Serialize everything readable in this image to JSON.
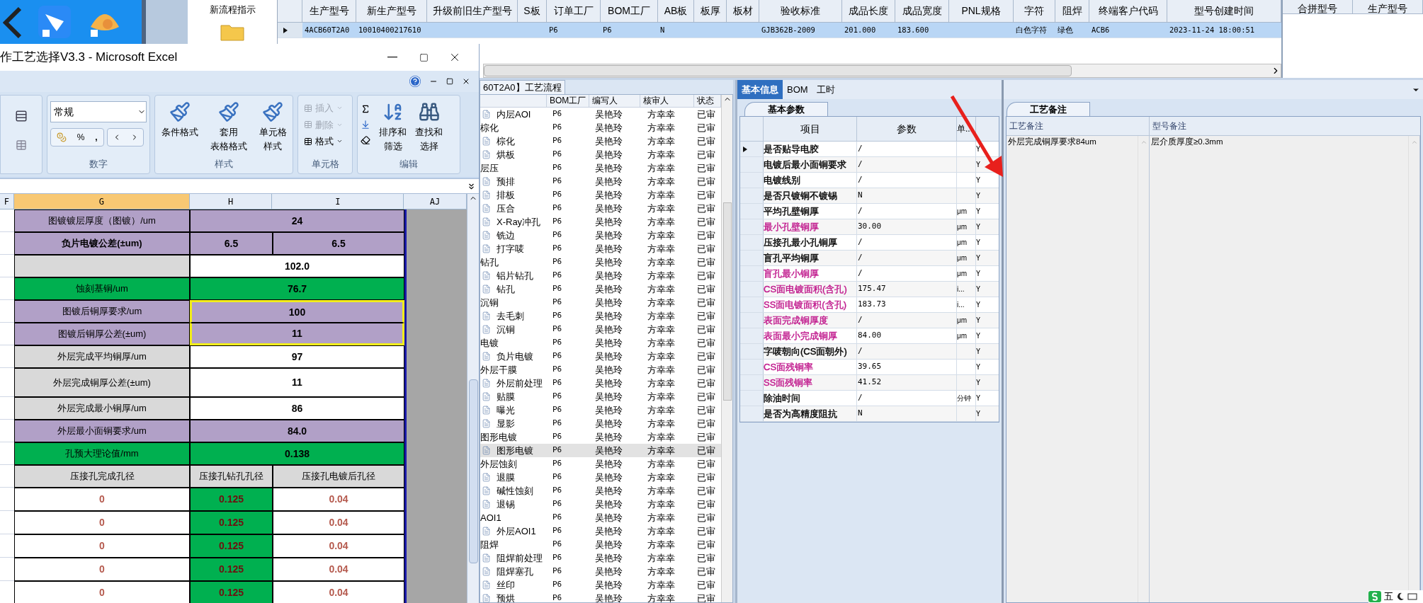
{
  "flow_panel": {
    "label": "新流程指示"
  },
  "model_grid": {
    "columns": [
      {
        "label": "生产型号"
      },
      {
        "label": "新生产型号"
      },
      {
        "label": "升级前旧生产型号"
      },
      {
        "label": "S板"
      },
      {
        "label": "订单工厂"
      },
      {
        "label": "BOM工厂"
      },
      {
        "label": "AB板"
      },
      {
        "label": "板厚"
      },
      {
        "label": "板材"
      },
      {
        "label": "验收标准"
      },
      {
        "label": "成品长度"
      },
      {
        "label": "成品宽度"
      },
      {
        "label": "PNL规格"
      },
      {
        "label": "字符"
      },
      {
        "label": "阻焊"
      },
      {
        "label": "终端客户代码"
      },
      {
        "label": "型号创建时间"
      }
    ],
    "rows": [
      {
        "selected": true,
        "cells": [
          "4ACB60T2A0",
          "10010400217610",
          "",
          "",
          "P6",
          "P6",
          "N",
          "",
          "",
          "GJB362B-2009",
          "201.000",
          "183.600",
          "",
          "白色字符",
          "绿色",
          "ACB6",
          "2023-11-24 18:00:51"
        ]
      }
    ]
  },
  "merge_grid": {
    "columns": [
      "合拼型号",
      "生产型号"
    ]
  },
  "excel": {
    "title": "作工艺选择V3.3 - Microsoft Excel",
    "number_format": "常规",
    "percent": "%",
    "comma": ",",
    "groups": [
      {
        "kind": "number",
        "label": "数字"
      },
      {
        "kind": "styles",
        "label": "样式"
      },
      {
        "kind": "cells",
        "label": "单元格"
      },
      {
        "kind": "editing",
        "label": "编辑"
      }
    ],
    "style_buttons": [
      {
        "lines": [
          "条件格式"
        ]
      },
      {
        "lines": [
          "套用",
          "表格格式"
        ]
      },
      {
        "lines": [
          "单元格",
          "样式"
        ]
      }
    ],
    "cell_buttons": [
      {
        "label": "插入",
        "disabled": true
      },
      {
        "label": "删除",
        "disabled": true
      },
      {
        "label": "格式",
        "disabled": false
      }
    ],
    "edit_buttons": [
      {
        "lines": [
          "排序和",
          "筛选"
        ]
      },
      {
        "lines": [
          "查找和",
          "选择"
        ]
      }
    ],
    "column_headers": [
      {
        "label": "F",
        "selected": false
      },
      {
        "label": "G",
        "selected": true
      },
      {
        "label": "H",
        "selected": false
      },
      {
        "label": "I",
        "selected": false
      },
      {
        "label": "AJ",
        "selected": false
      }
    ],
    "rows": [
      {
        "kind": "input",
        "label": "图镀镀层厚度（图镀）/um",
        "bold": false,
        "highlighted": false,
        "values": [
          "24"
        ]
      },
      {
        "kind": "input",
        "label": "负片电镀公差(±um)",
        "bold": true,
        "highlighted": false,
        "values": [
          "6.5",
          "6.5"
        ]
      },
      {
        "kind": "derived",
        "highlighted": false,
        "values": [
          "102.0"
        ]
      },
      {
        "kind": "result",
        "label": "蚀刻基铜/um",
        "bold": false,
        "highlighted": false,
        "values": [
          "76.7"
        ]
      },
      {
        "kind": "input",
        "label": "图镀后铜厚要求/um",
        "bold": false,
        "highlighted": true,
        "values": [
          "100"
        ]
      },
      {
        "kind": "input",
        "label": "图镀后铜厚公差(±um)",
        "bold": false,
        "highlighted": true,
        "values": [
          "11"
        ]
      },
      {
        "kind": "derived",
        "label": "外层完成平均铜厚/um",
        "bold": false,
        "highlighted": false,
        "values": [
          "97"
        ]
      },
      {
        "kind": "derived",
        "label": "外层完成铜厚公差(±um)",
        "bold": false,
        "highlighted": false,
        "values": [
          "11"
        ]
      },
      {
        "kind": "derived",
        "label": "外层完成最小铜厚/um",
        "bold": false,
        "highlighted": false,
        "values": [
          "86"
        ]
      },
      {
        "kind": "input",
        "label": "外层最小面铜要求/um",
        "bold": false,
        "highlighted": false,
        "values": [
          "84.0"
        ]
      },
      {
        "kind": "result",
        "label": "孔预大理论值/mm",
        "bold": false,
        "highlighted": false,
        "values": [
          "0.138"
        ]
      }
    ],
    "hole_table": {
      "columns": [
        "压接孔完成孔径",
        "压接孔钻孔孔径",
        "压接孔电镀后孔径"
      ],
      "rows": [
        [
          "0",
          "0.125",
          "0.04"
        ],
        [
          "0",
          "0.125",
          "0.04"
        ],
        [
          "0",
          "0.125",
          "0.04"
        ],
        [
          "0",
          "0.125",
          "0.04"
        ],
        [
          "0",
          "0.125",
          "0.04"
        ]
      ]
    }
  },
  "process": {
    "tab": "60T2A0】工艺流程",
    "columns": [
      "BOM工厂",
      "编写人",
      "核审人",
      "状态"
    ],
    "items": [
      {
        "kind": "step",
        "name": "内层AOI",
        "bom_factory": "P6",
        "author": "吴艳玲",
        "reviewer": "方幸幸",
        "status": "已审",
        "selected": false
      },
      {
        "kind": "group",
        "name": "棕化",
        "bom_factory": "P6",
        "author": "吴艳玲",
        "reviewer": "方幸幸",
        "status": "已审",
        "selected": false,
        "children": [
          {
            "kind": "step",
            "name": "棕化",
            "bom_factory": "P6",
            "author": "吴艳玲",
            "reviewer": "方幸幸",
            "status": "已审",
            "selected": false
          },
          {
            "kind": "step",
            "name": "烘板",
            "bom_factory": "P6",
            "author": "吴艳玲",
            "reviewer": "方幸幸",
            "status": "已审",
            "selected": false
          }
        ]
      },
      {
        "kind": "group",
        "name": "层压",
        "bom_factory": "P6",
        "author": "吴艳玲",
        "reviewer": "方幸幸",
        "status": "已审",
        "selected": false,
        "children": [
          {
            "kind": "step",
            "name": "预排",
            "bom_factory": "P6",
            "author": "吴艳玲",
            "reviewer": "方幸幸",
            "status": "已审",
            "selected": false
          },
          {
            "kind": "step",
            "name": "排板",
            "bom_factory": "P6",
            "author": "吴艳玲",
            "reviewer": "方幸幸",
            "status": "已审",
            "selected": false
          },
          {
            "kind": "step",
            "name": "压合",
            "bom_factory": "P6",
            "author": "吴艳玲",
            "reviewer": "方幸幸",
            "status": "已审",
            "selected": false
          },
          {
            "kind": "step",
            "name": "X-Ray冲孔",
            "bom_factory": "P6",
            "author": "吴艳玲",
            "reviewer": "方幸幸",
            "status": "已审",
            "selected": false
          },
          {
            "kind": "step",
            "name": "铣边",
            "bom_factory": "P6",
            "author": "吴艳玲",
            "reviewer": "方幸幸",
            "status": "已审",
            "selected": false
          },
          {
            "kind": "step",
            "name": "打字唛",
            "bom_factory": "P6",
            "author": "吴艳玲",
            "reviewer": "方幸幸",
            "status": "已审",
            "selected": false
          }
        ]
      },
      {
        "kind": "group",
        "name": "钻孔",
        "bom_factory": "P6",
        "author": "吴艳玲",
        "reviewer": "方幸幸",
        "status": "已审",
        "selected": false,
        "children": [
          {
            "kind": "step",
            "name": "铝片钻孔",
            "bom_factory": "P6",
            "author": "吴艳玲",
            "reviewer": "方幸幸",
            "status": "已审",
            "selected": false
          },
          {
            "kind": "step",
            "name": "钻孔",
            "bom_factory": "P6",
            "author": "吴艳玲",
            "reviewer": "方幸幸",
            "status": "已审",
            "selected": false
          }
        ]
      },
      {
        "kind": "group",
        "name": "沉铜",
        "bom_factory": "P6",
        "author": "吴艳玲",
        "reviewer": "方幸幸",
        "status": "已审",
        "selected": false,
        "children": [
          {
            "kind": "step",
            "name": "去毛刺",
            "bom_factory": "P6",
            "author": "吴艳玲",
            "reviewer": "方幸幸",
            "status": "已审",
            "selected": false
          },
          {
            "kind": "step",
            "name": "沉铜",
            "bom_factory": "P6",
            "author": "吴艳玲",
            "reviewer": "方幸幸",
            "status": "已审",
            "selected": false
          }
        ]
      },
      {
        "kind": "group",
        "name": "电镀",
        "bom_factory": "P6",
        "author": "吴艳玲",
        "reviewer": "方幸幸",
        "status": "已审",
        "selected": false,
        "children": [
          {
            "kind": "step",
            "name": "负片电镀",
            "bom_factory": "P6",
            "author": "吴艳玲",
            "reviewer": "方幸幸",
            "status": "已审",
            "selected": false
          }
        ]
      },
      {
        "kind": "group",
        "name": "外层干膜",
        "bom_factory": "P6",
        "author": "吴艳玲",
        "reviewer": "方幸幸",
        "status": "已审",
        "selected": false,
        "children": [
          {
            "kind": "step",
            "name": "外层前处理",
            "bom_factory": "P6",
            "author": "吴艳玲",
            "reviewer": "方幸幸",
            "status": "已审",
            "selected": false
          },
          {
            "kind": "step",
            "name": "贴膜",
            "bom_factory": "P6",
            "author": "吴艳玲",
            "reviewer": "方幸幸",
            "status": "已审",
            "selected": false
          },
          {
            "kind": "step",
            "name": "曝光",
            "bom_factory": "P6",
            "author": "吴艳玲",
            "reviewer": "方幸幸",
            "status": "已审",
            "selected": false
          },
          {
            "kind": "step",
            "name": "显影",
            "bom_factory": "P6",
            "author": "吴艳玲",
            "reviewer": "方幸幸",
            "status": "已审",
            "selected": false
          }
        ]
      },
      {
        "kind": "group",
        "name": "图形电镀",
        "bom_factory": "P6",
        "author": "吴艳玲",
        "reviewer": "方幸幸",
        "status": "已审",
        "selected": false,
        "children": [
          {
            "kind": "step",
            "name": "图形电镀",
            "bom_factory": "P6",
            "author": "吴艳玲",
            "reviewer": "方幸幸",
            "status": "已审",
            "selected": true
          }
        ]
      },
      {
        "kind": "group",
        "name": "外层蚀刻",
        "bom_factory": "P6",
        "author": "吴艳玲",
        "reviewer": "方幸幸",
        "status": "已审",
        "selected": false,
        "children": [
          {
            "kind": "step",
            "name": "退膜",
            "bom_factory": "P6",
            "author": "吴艳玲",
            "reviewer": "方幸幸",
            "status": "已审",
            "selected": false
          },
          {
            "kind": "step",
            "name": "碱性蚀刻",
            "bom_factory": "P6",
            "author": "吴艳玲",
            "reviewer": "方幸幸",
            "status": "已审",
            "selected": false
          },
          {
            "kind": "step",
            "name": "退锡",
            "bom_factory": "P6",
            "author": "吴艳玲",
            "reviewer": "方幸幸",
            "status": "已审",
            "selected": false
          }
        ]
      },
      {
        "kind": "group",
        "name": "AOI1",
        "bom_factory": "P6",
        "author": "吴艳玲",
        "reviewer": "方幸幸",
        "status": "已审",
        "selected": false,
        "children": [
          {
            "kind": "step",
            "name": "外层AOI1",
            "bom_factory": "P6",
            "author": "吴艳玲",
            "reviewer": "方幸幸",
            "status": "已审",
            "selected": false
          }
        ]
      },
      {
        "kind": "group",
        "name": "阻焊",
        "bom_factory": "P6",
        "author": "吴艳玲",
        "reviewer": "方幸幸",
        "status": "已审",
        "selected": false,
        "children": [
          {
            "kind": "step",
            "name": "阻焊前处理",
            "bom_factory": "P6",
            "author": "吴艳玲",
            "reviewer": "方幸幸",
            "status": "已审",
            "selected": false
          },
          {
            "kind": "step",
            "name": "阻焊塞孔",
            "bom_factory": "P6",
            "author": "吴艳玲",
            "reviewer": "方幸幸",
            "status": "已审",
            "selected": false
          },
          {
            "kind": "step",
            "name": "丝印",
            "bom_factory": "P6",
            "author": "吴艳玲",
            "reviewer": "方幸幸",
            "status": "已审",
            "selected": false
          },
          {
            "kind": "step",
            "name": "预烘",
            "bom_factory": "P6",
            "author": "吴艳玲",
            "reviewer": "方幸幸",
            "status": "已审",
            "selected": false
          }
        ]
      }
    ]
  },
  "detail": {
    "tabs": [
      {
        "label": "基本信息",
        "selected": true
      },
      {
        "label": "BOM",
        "selected": false
      },
      {
        "label": "工时",
        "selected": false
      }
    ],
    "subtab": "基本参数",
    "columns": [
      "项目",
      "参数",
      "单..."
    ],
    "rows": [
      {
        "item": "是否贴导电胶",
        "value": "/",
        "unit": "",
        "flag": "Y",
        "color": "#000000",
        "current": true
      },
      {
        "item": "电镀后最小面铜要求",
        "value": "/",
        "unit": "",
        "flag": "Y",
        "color": "#000000",
        "current": false
      },
      {
        "item": "电镀线别",
        "value": "/",
        "unit": "",
        "flag": "Y",
        "color": "#000000",
        "current": false
      },
      {
        "item": "是否只镀铜不镀锡",
        "value": "N",
        "unit": "",
        "flag": "Y",
        "color": "#000000",
        "current": false
      },
      {
        "item": "平均孔壁铜厚",
        "value": "/",
        "unit": "μm",
        "flag": "Y",
        "color": "#000000",
        "current": false
      },
      {
        "item": "最小孔壁铜厚",
        "value": "30.00",
        "unit": "μm",
        "flag": "Y",
        "color": "#c0188c",
        "current": false
      },
      {
        "item": "压接孔最小孔铜厚",
        "value": "/",
        "unit": "μm",
        "flag": "Y",
        "color": "#000000",
        "current": false
      },
      {
        "item": "盲孔平均铜厚",
        "value": "/",
        "unit": "μm",
        "flag": "Y",
        "color": "#000000",
        "current": false
      },
      {
        "item": "盲孔最小铜厚",
        "value": "/",
        "unit": "μm",
        "flag": "Y",
        "color": "#c0188c",
        "current": false
      },
      {
        "item": "CS面电镀面积(含孔)",
        "value": "175.47",
        "unit": "i...",
        "flag": "Y",
        "color": "#c0188c",
        "current": false
      },
      {
        "item": "SS面电镀面积(含孔)",
        "value": "183.73",
        "unit": "i...",
        "flag": "Y",
        "color": "#c0188c",
        "current": false
      },
      {
        "item": "表面完成铜厚度",
        "value": "/",
        "unit": "μm",
        "flag": "Y",
        "color": "#c0188c",
        "current": false
      },
      {
        "item": "表面最小完成铜厚",
        "value": "84.00",
        "unit": "μm",
        "flag": "Y",
        "color": "#c0188c",
        "current": false
      },
      {
        "item": "字唛朝向(CS面朝外)",
        "value": "/",
        "unit": "",
        "flag": "Y",
        "color": "#000000",
        "current": false
      },
      {
        "item": "CS面残铜率",
        "value": "39.65",
        "unit": "",
        "flag": "Y",
        "color": "#c0188c",
        "current": false
      },
      {
        "item": "SS面残铜率",
        "value": "41.52",
        "unit": "",
        "flag": "Y",
        "color": "#c0188c",
        "current": false
      },
      {
        "item": "除油时间",
        "value": "/",
        "unit": "分钟",
        "flag": "Y",
        "color": "#000000",
        "current": false
      },
      {
        "item": "是否为高精度阻抗",
        "value": "N",
        "unit": "",
        "flag": "Y",
        "color": "#000000",
        "current": false
      }
    ]
  },
  "notes": {
    "tab": "工艺备注",
    "columns": [
      "工艺备注",
      "型号备注"
    ],
    "values": [
      "外层完成铜厚要求84um",
      "层介质厚度≥0.3mm"
    ]
  },
  "ime": {
    "mode": "五"
  }
}
